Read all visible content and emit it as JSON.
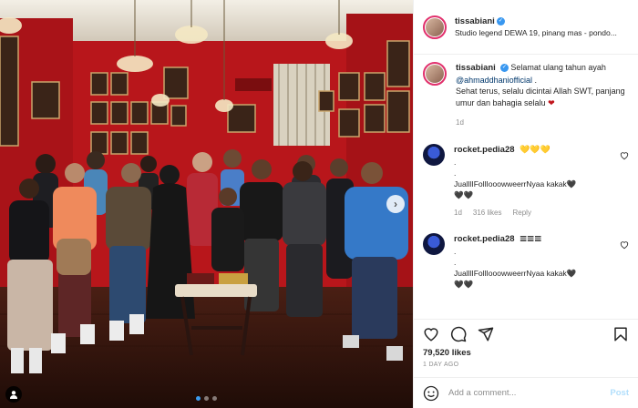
{
  "post": {
    "username": "tissabiani",
    "location": "Studio legend DEWA 19, pinang mas - pondo...",
    "caption": {
      "text_before": "Selamat ulang tahun ayah ",
      "mention": "@ahmaddhaniofficial",
      "text_after": " .",
      "line2": "Sehat terus, selalu dicintai Allah SWT, panjang umur dan bahagia selalu",
      "heart": "❤",
      "age": "1d"
    },
    "likes": "79,520 likes",
    "timestamp": "1 DAY AGO"
  },
  "comments": [
    {
      "username": "rocket.pedia28",
      "emoji": "💛💛💛",
      "lines": [
        ".",
        ".",
        "JualllIFollIooowweerrNyaa kakak🖤",
        "🖤🖤"
      ],
      "age": "1d",
      "likes": "316 likes",
      "reply": "Reply"
    },
    {
      "username": "rocket.pedia28",
      "emoji": "𝌆𝌆𝌆",
      "lines": [
        ".",
        ".",
        "JualllIFollIooowweerrNyaa kakak🖤",
        "🖤🖤"
      ]
    }
  ],
  "add_comment": {
    "placeholder": "Add a comment...",
    "post_label": "Post"
  },
  "icons": {
    "like": "heart-icon",
    "comment": "comment-icon",
    "share": "share-icon",
    "save": "bookmark-icon",
    "emoji": "emoji-icon",
    "tag": "user-tag-icon",
    "next": "chevron-right-icon"
  },
  "colors": {
    "verified": "#3897f0",
    "link": "#00376b",
    "post_disabled": "#b2dffc",
    "wall": "#c4151c"
  }
}
